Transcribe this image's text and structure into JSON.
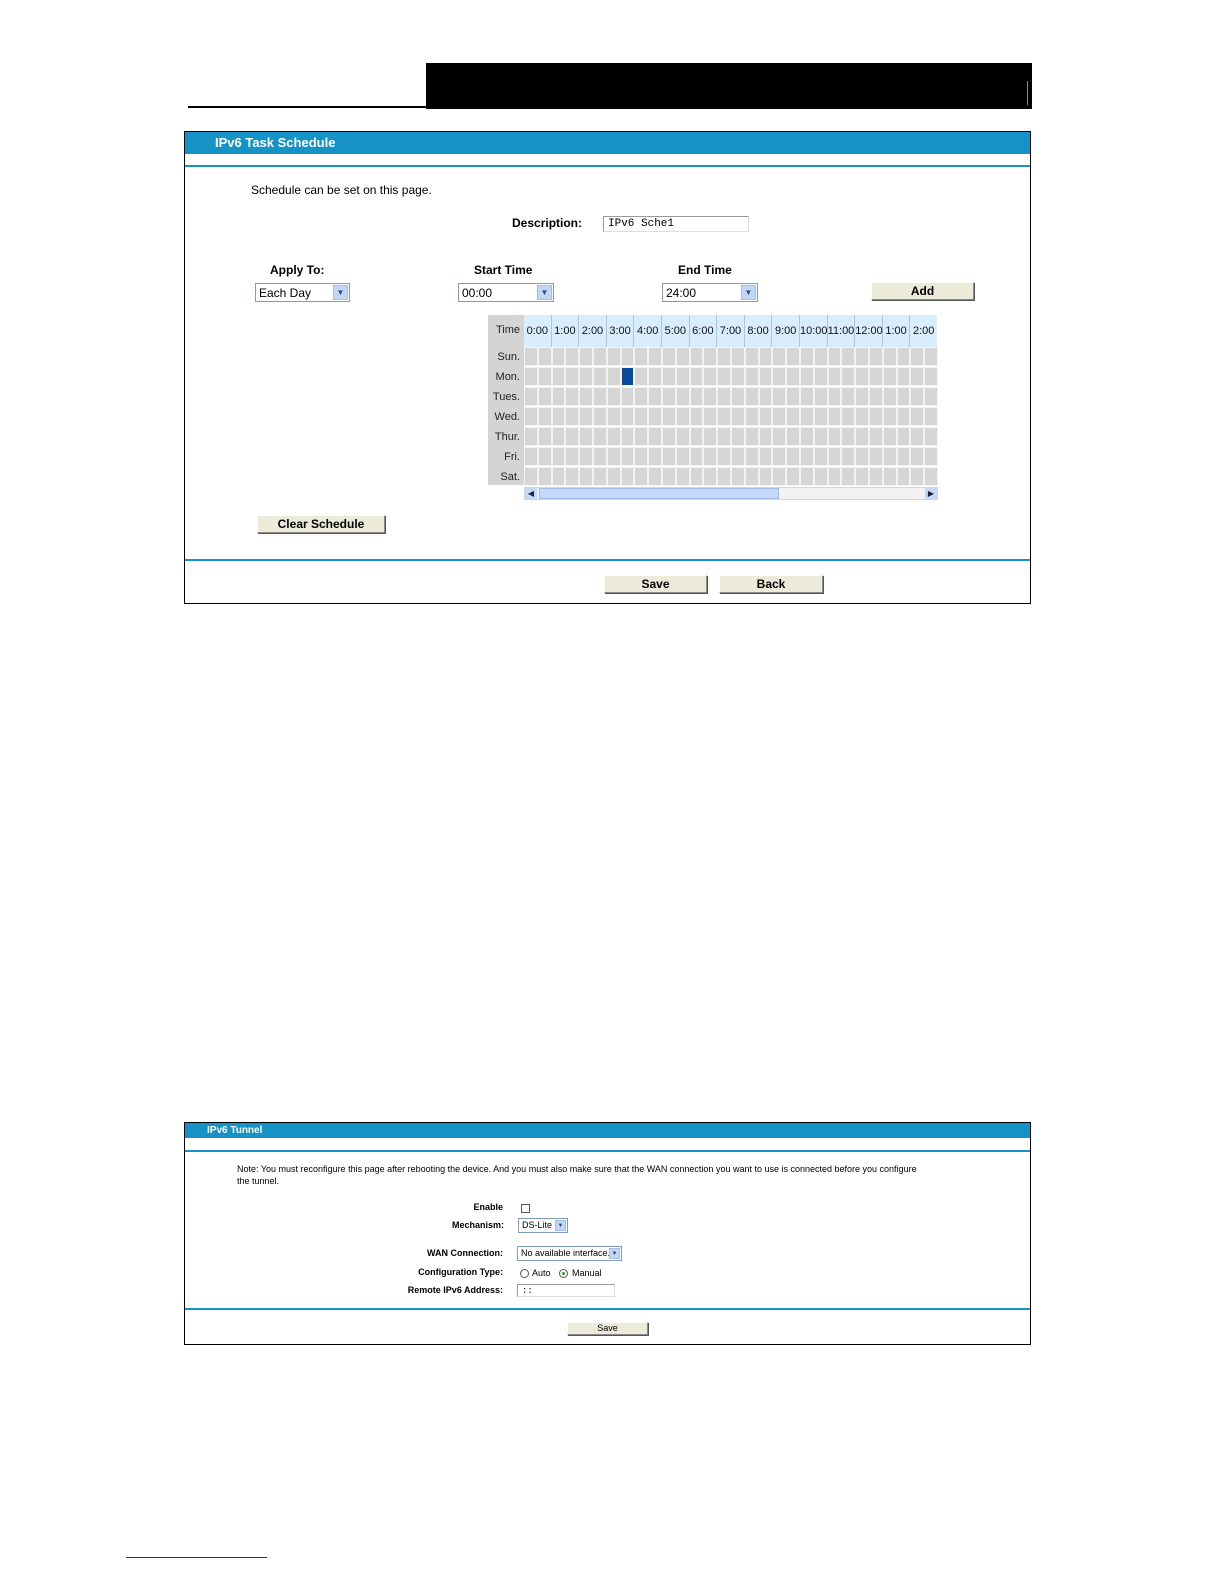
{
  "schedule_panel": {
    "title": "IPv6 Task Schedule",
    "intro": "Schedule can be set on this page.",
    "description_label": "Description:",
    "description_value": "IPv6 Sche1",
    "apply_to_label": "Apply To:",
    "apply_to_value": "Each Day",
    "start_time_label": "Start Time",
    "start_time_value": "00:00",
    "end_time_label": "End Time",
    "end_time_value": "24:00",
    "add_label": "Add",
    "clear_label": "Clear Schedule",
    "save_label": "Save",
    "back_label": "Back",
    "grid": {
      "corner_label": "Time",
      "hours": [
        "0:00",
        "1:00",
        "2:00",
        "3:00",
        "4:00",
        "5:00",
        "6:00",
        "7:00",
        "8:00",
        "9:00",
        "10:00",
        "11:00",
        "12:00",
        "1:00",
        "2:00"
      ],
      "days": [
        "Sun.",
        "Mon.",
        "Tues.",
        "Wed.",
        "Thur.",
        "Fri.",
        "Sat."
      ],
      "selected": [
        {
          "day": "Mon.",
          "hour": "3:00",
          "half": 2
        }
      ]
    }
  },
  "tunnel_panel": {
    "title": "IPv6 Tunnel",
    "note_line1": "Note: You must reconfigure this page after rebooting the device. And you must also make sure that the WAN connection you want to use is connected before you configure",
    "note_line2": "the tunnel.",
    "enable_label": "Enable",
    "mechanism_label": "Mechanism:",
    "mechanism_value": "DS-Lite",
    "wan_label": "WAN Connection:",
    "wan_value": "No available interface.",
    "config_type_label": "Configuration Type:",
    "auto_label": "Auto",
    "manual_label": "Manual",
    "remote_label": "Remote IPv6 Address:",
    "remote_value": "::",
    "save_label": "Save"
  }
}
